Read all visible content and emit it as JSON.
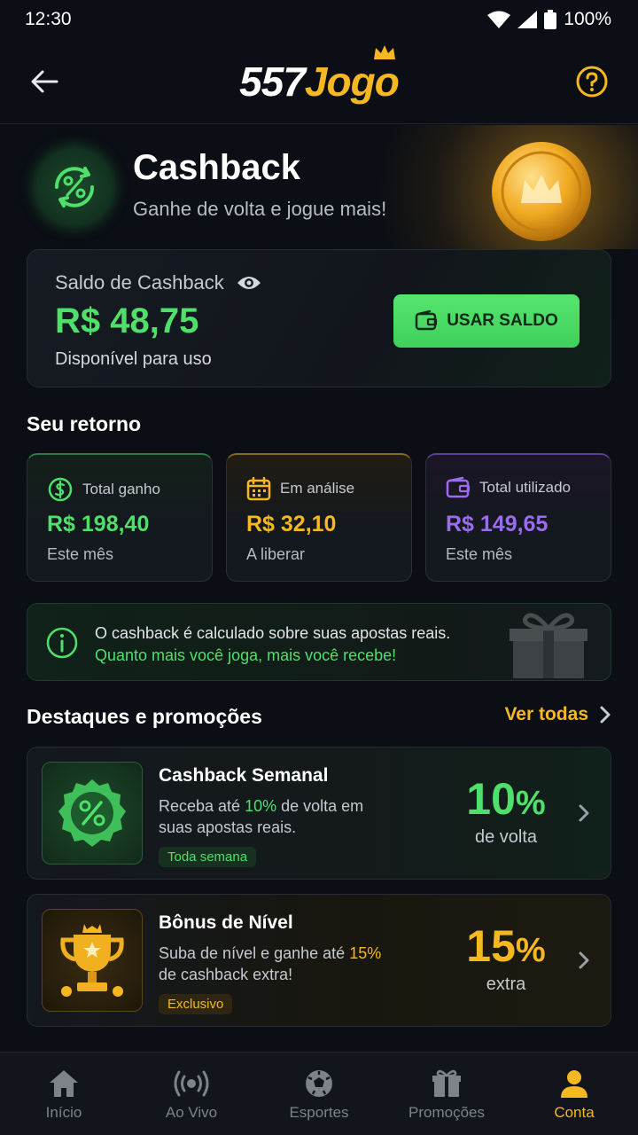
{
  "status_bar": {
    "time": "12:30",
    "battery": "100%"
  },
  "header": {
    "logo_number": "557",
    "logo_brand": "Jogo"
  },
  "hero": {
    "title": "Cashback",
    "subtitle": "Ganhe de volta e jogue mais!"
  },
  "balance": {
    "label": "Saldo de Cashback",
    "amount": "R$ 48,75",
    "note": "Disponível para uso",
    "button_label": "USAR SALDO"
  },
  "returns": {
    "title": "Seu retorno",
    "cards": [
      {
        "label": "Total ganho",
        "value": "R$ 198,40",
        "sub": "Este mês",
        "color": "#4ee06a"
      },
      {
        "label": "Em análise",
        "value": "R$ 32,10",
        "sub": "A liberar",
        "color": "#f5b820"
      },
      {
        "label": "Total utilizado",
        "value": "R$ 149,65",
        "sub": "Este mês",
        "color": "#9b6cf0"
      }
    ]
  },
  "info": {
    "line1": "O cashback é calculado sobre suas apostas reais.",
    "line2": "Quanto mais você joga, mais você recebe!"
  },
  "promotions": {
    "title": "Destaques e promoções",
    "see_all": "Ver todas",
    "items": [
      {
        "title": "Cashback Semanal",
        "desc_pre": "Receba até ",
        "desc_hl": "10%",
        "desc_post": " de volta em suas apostas reais.",
        "tag": "Toda semana",
        "pct": "10",
        "pct_symbol": "%",
        "pct_sub": "de volta",
        "color": "#4ee06a"
      },
      {
        "title": "Bônus de Nível",
        "desc_pre": "Suba de nível e ganhe até ",
        "desc_hl": "15%",
        "desc_post": " de cashback extra!",
        "tag": "Exclusivo",
        "pct": "15",
        "pct_symbol": "%",
        "pct_sub": "extra",
        "color": "#f5b820"
      }
    ]
  },
  "nav": {
    "items": [
      {
        "label": "Início",
        "icon": "home-icon"
      },
      {
        "label": "Ao Vivo",
        "icon": "live-icon"
      },
      {
        "label": "Esportes",
        "icon": "soccer-ball-icon"
      },
      {
        "label": "Promoções",
        "icon": "gift-icon"
      },
      {
        "label": "Conta",
        "icon": "user-icon"
      }
    ],
    "active": "Conta"
  }
}
